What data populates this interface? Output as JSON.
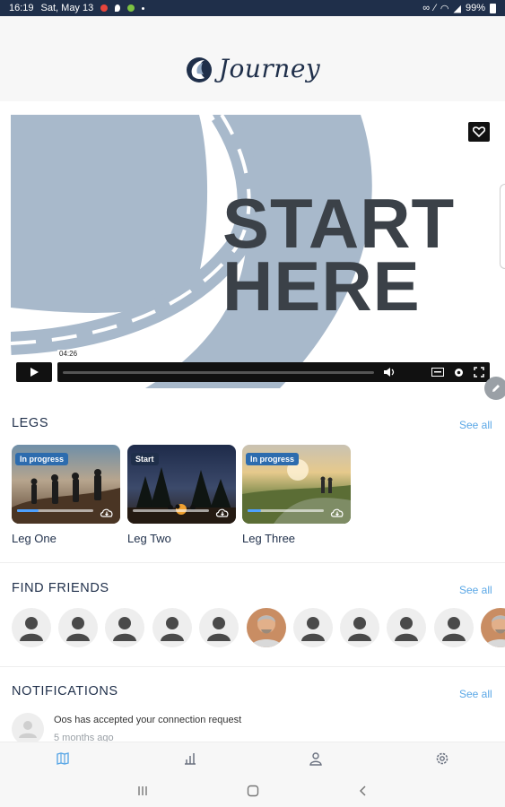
{
  "status_bar": {
    "time": "16:19",
    "date": "Sat, May 13",
    "battery": "99%"
  },
  "app": {
    "logo_text": "Journey"
  },
  "video": {
    "overlay_line1": "START",
    "overlay_line2": "HERE",
    "timestamp": "04:26"
  },
  "legs": {
    "title": "LEGS",
    "see_all": "See all",
    "items": [
      {
        "label": "Leg One",
        "badge": "In progress",
        "progress": 0.28
      },
      {
        "label": "Leg Two",
        "badge": "Start",
        "progress": 0.0
      },
      {
        "label": "Leg Three",
        "badge": "In progress",
        "progress": 0.18
      }
    ]
  },
  "friends": {
    "title": "FIND FRIENDS",
    "see_all": "See all"
  },
  "notifications": {
    "title": "NOTIFICATIONS",
    "see_all": "See all",
    "items": [
      {
        "text": "Oos has accepted your connection request",
        "time": "5 months ago"
      }
    ]
  },
  "colors": {
    "status_bar": "#1f2f4a",
    "accent_link": "#5aa7e6",
    "badge": "#2d6cae",
    "road_blue": "#a8b9cb"
  }
}
